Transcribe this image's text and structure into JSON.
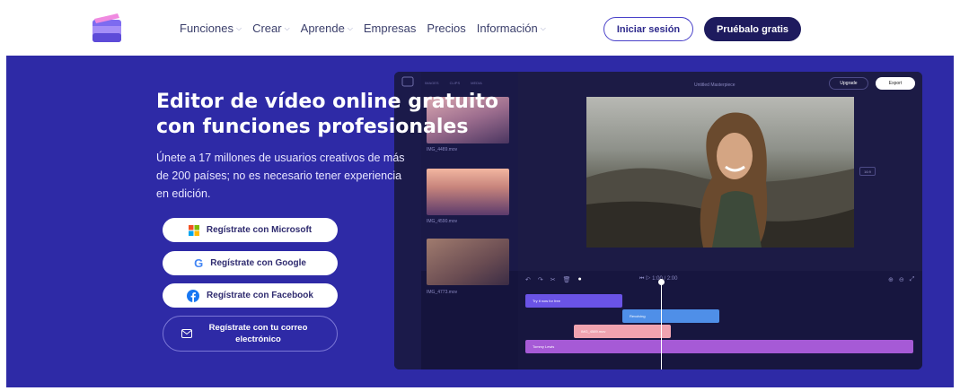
{
  "nav": {
    "links": [
      {
        "label": "Funciones",
        "dropdown": true
      },
      {
        "label": "Crear",
        "dropdown": true
      },
      {
        "label": "Aprende",
        "dropdown": true
      },
      {
        "label": "Empresas",
        "dropdown": false
      },
      {
        "label": "Precios",
        "dropdown": false
      },
      {
        "label": "Información",
        "dropdown": true
      }
    ],
    "login_label": "Iniciar sesión",
    "try_label": "Pruébalo gratis"
  },
  "hero": {
    "headline": "Editor de vídeo online gratuito con funciones profesionales",
    "subtext": "Únete a 17 millones de usuarios creativos de más de 200 países; no es necesario tener experiencia en edición.",
    "signup": {
      "microsoft": "Regístrate con Microsoft",
      "google": "Regístrate con Google",
      "facebook": "Regístrate con Facebook",
      "email": "Regístrate con tu correo electrónico"
    }
  },
  "editor": {
    "tabs": [
      "IMAGES",
      "CLIPS",
      "MEDIA"
    ],
    "title": "Untitled Masterpiece",
    "upgrade": "Upgrade",
    "export": "Export",
    "aspect_ratio": "16:9",
    "media": [
      {
        "name": "IMG_4489.mov"
      },
      {
        "name": "IMG_4590.mov"
      },
      {
        "name": "IMG_4773.mov"
      }
    ],
    "time": "1:00 / 2:00",
    "clips": [
      {
        "label": "Try it now for free",
        "color": "#6a53e6"
      },
      {
        "label": "Revolving",
        "color": "#4f8fe8"
      },
      {
        "label": "IMG_4589.mov",
        "color": "#f0a3b0"
      },
      {
        "label": "Tommy Lewis",
        "color": "#a65ad6"
      }
    ]
  },
  "colors": {
    "hero_bg": "#2e2aa6",
    "nav_dark": "#1e1b5e",
    "accent": "#4a42c9"
  }
}
